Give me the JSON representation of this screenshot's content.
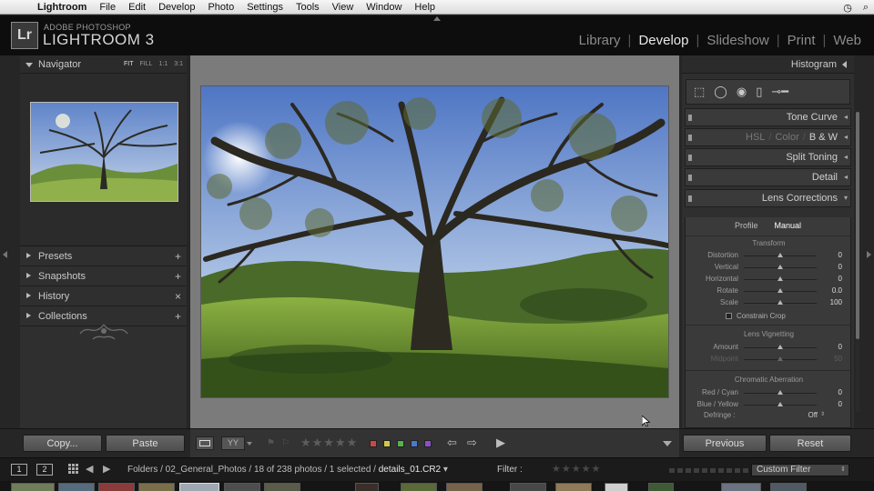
{
  "menubar": {
    "app": "Lightroom",
    "items": [
      "File",
      "Edit",
      "Develop",
      "Photo",
      "Settings",
      "Tools",
      "View",
      "Window",
      "Help"
    ]
  },
  "identity": {
    "badge": "Lr",
    "small": "ADOBE PHOTOSHOP",
    "big": "LIGHTROOM 3"
  },
  "modules": [
    "Library",
    "Develop",
    "Slideshow",
    "Print",
    "Web"
  ],
  "left_panel": {
    "navigator": {
      "title": "Navigator",
      "zoom": [
        "FIT",
        "FILL",
        "1:1",
        "3:1"
      ]
    },
    "sections": [
      {
        "label": "Presets",
        "action": "+"
      },
      {
        "label": "Snapshots",
        "action": "+"
      },
      {
        "label": "History",
        "action": "×"
      },
      {
        "label": "Collections",
        "action": "+"
      }
    ]
  },
  "right_panel": {
    "histogram": "Histogram",
    "tone_curve": "Tone Curve",
    "hsl": {
      "hsl": "HSL",
      "color": "Color",
      "bw": "B & W"
    },
    "split_toning": "Split Toning",
    "detail": "Detail",
    "lens": {
      "title": "Lens Corrections",
      "tabs": [
        "Profile",
        "Manual"
      ],
      "transform": "Transform",
      "sliders": [
        {
          "label": "Distortion",
          "value": "0",
          "pos": 0.5
        },
        {
          "label": "Vertical",
          "value": "0",
          "pos": 0.5
        },
        {
          "label": "Horizontal",
          "value": "0",
          "pos": 0.5
        },
        {
          "label": "Rotate",
          "value": "0.0",
          "pos": 0.5
        },
        {
          "label": "Scale",
          "value": "100",
          "pos": 0.5
        }
      ],
      "constrain": "Constrain Crop",
      "vignetting": "Lens Vignetting",
      "amount": {
        "label": "Amount",
        "value": "0",
        "pos": 0.5
      },
      "midpoint": {
        "label": "Midpoint",
        "value": "50",
        "pos": 0.5
      },
      "ca": "Chromatic Aberration",
      "red_cyan": {
        "label": "Red / Cyan",
        "value": "0",
        "pos": 0.5
      },
      "blue_yellow": {
        "label": "Blue / Yellow",
        "value": "0",
        "pos": 0.5
      },
      "defringe": {
        "label": "Defringe :",
        "value": "Off"
      }
    }
  },
  "bottom": {
    "copy": "Copy...",
    "paste": "Paste",
    "previous": "Previous",
    "reset": "Reset",
    "yy": "YY",
    "stars": "★★★★★",
    "colors": [
      "#c84848",
      "#cfc94a",
      "#56b24e",
      "#4f78c9",
      "#8a4fc9"
    ]
  },
  "filmbar": {
    "screen1": "1",
    "screen2": "2",
    "path_prefix": "Folders / 02_General_Photos / 18 of 238 photos / 1 selected / ",
    "filename": "details_01.CR2",
    "filter": "Filter :",
    "filter_stars": "★★★★★",
    "custom_filter": "Custom Filter"
  }
}
